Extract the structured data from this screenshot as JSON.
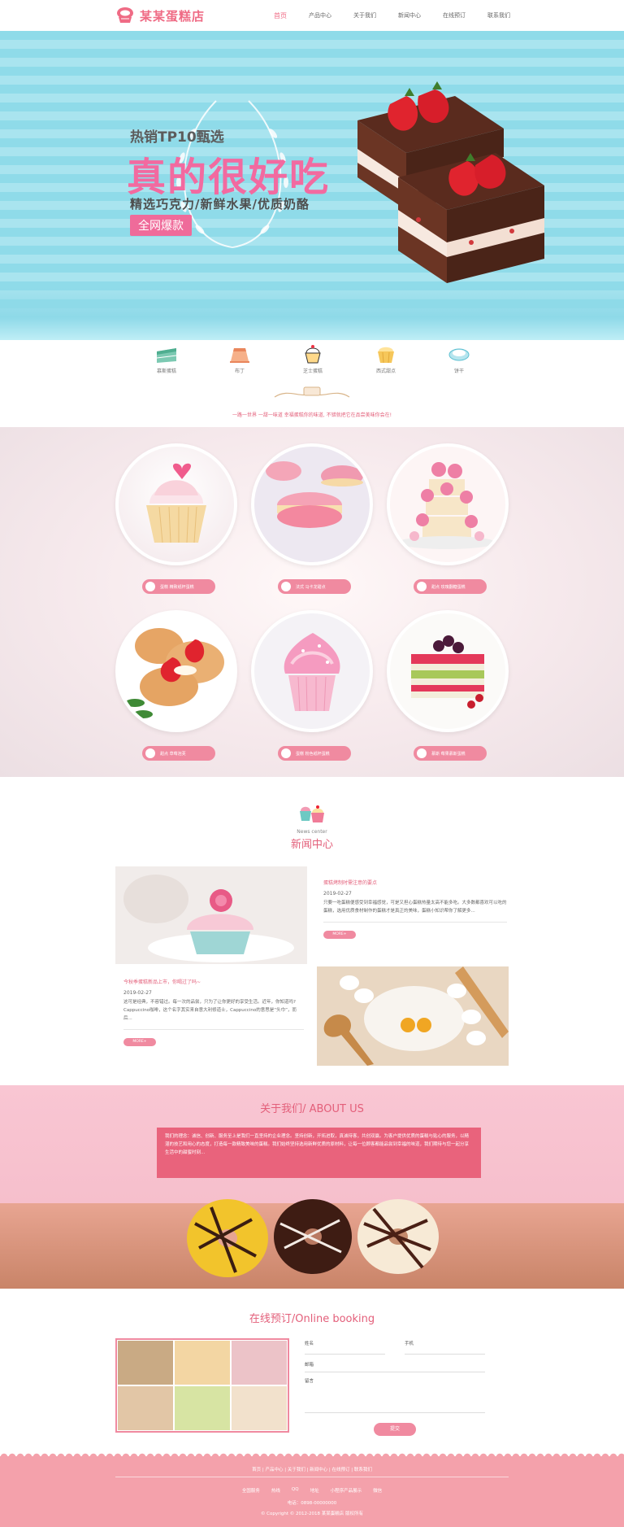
{
  "header": {
    "logo_text": "某某蛋糕店",
    "nav": [
      "首页",
      "产品中心",
      "关于我们",
      "新闻中心",
      "在线预订",
      "联系我们"
    ]
  },
  "banner": {
    "line1": "热销TP10甄选",
    "headline": "真的很好吃",
    "line3": "精选巧克力/新鲜水果/优质奶酪",
    "tag": "全网爆款"
  },
  "categories": [
    "慕斯蛋糕",
    "布丁",
    "芝士蛋糕",
    "西式甜点",
    "饼干"
  ],
  "tagline": "一路一世界 一甜一味道 幸福蛋糕你的味道, 不错就把它在品尝美味你会在!",
  "products": [
    {
      "label": "蛋糕 精致纸杯蛋糕"
    },
    {
      "label": "法式 马卡龙甜点"
    },
    {
      "label": "甜点 玫瑰翻糖蛋糕"
    },
    {
      "label": "甜点 草莓泡芙"
    },
    {
      "label": "蛋糕 粉色纸杯蛋糕"
    },
    {
      "label": "慕斯 莓果慕斯蛋糕"
    }
  ],
  "news": {
    "en": "News center",
    "cn": "新闻中心",
    "items": [
      {
        "title": "蛋糕烤制时需注意的要点",
        "date": "2019-02-27",
        "text": "只要一吃蛋糕便感受到幸福感觉，可是又担心蛋糕热量太高不能多吃。大多数都喜欢可以吃的蛋糕，选用优质食材制作的蛋糕才是真正的美味，蛋糕小知识帮你了解更多...",
        "more": "MORE+"
      },
      {
        "title": "今秋季蛋糕新品上市，你喝过了吗~",
        "date": "2019-02-27",
        "text": "这可是经典，不容错过。每一次的品尝，只为了让你更好的享受生活。近年，你知道吗? Cappuccino咖啡，这个名字其实来自意大利修道士，Cappuccino的意思是“头巾”，而后...",
        "more": "MORE+"
      }
    ]
  },
  "about": {
    "title": "关于我们/ ABOUT US",
    "text": "我们的理念：诚信、创新、服务至上是我们一直坚持的企业理念。坚持创新，开拓进取，真诚待客，共创双赢。为客户提供优质的蛋糕与贴心的服务，以精湛的技艺和用心的态度，打造每一款精致美味的蛋糕。我们始终坚持选用新鲜优质的原材料，让每一位顾客都能品尝到幸福的味道，我们期待与您一起分享生活中的甜蜜时刻..."
  },
  "booking": {
    "title": "在线预订/Online booking",
    "fields": {
      "name": "姓名",
      "phone": "手机",
      "email": "邮箱",
      "message": "留言"
    },
    "submit": "提交"
  },
  "footer": {
    "links": "首页 | 产品中心 | 关于我们 | 新闻中心 | 在线预订 | 联系我们",
    "contact": [
      "全国服务",
      "热线",
      "QQ",
      "地址",
      "小程序产品展示",
      "微信"
    ],
    "tel": "电话：0898-00000000",
    "copyright": "© Copyright © 2012-2018 某某蛋糕店 版权所有"
  },
  "colors": {
    "brand_pink": "#ef6b85",
    "banner_blue": "#8fdbe9",
    "footer": "#f4a1ab"
  }
}
